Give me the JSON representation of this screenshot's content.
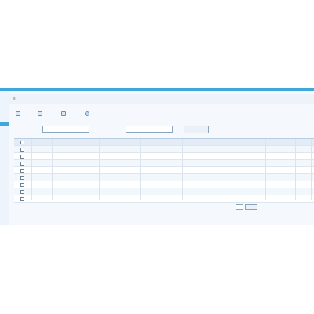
{
  "breadcrumb": {
    "icon": "home-icon",
    "path": ""
  },
  "toolbar": [
    {
      "name": "add-button",
      "icon": "add-icon",
      "label": ""
    },
    {
      "name": "edit-button",
      "icon": "edit-icon",
      "label": ""
    },
    {
      "name": "delete-button",
      "icon": "delete-icon",
      "label": ""
    },
    {
      "name": "refresh-button",
      "icon": "refresh-icon",
      "label": ""
    }
  ],
  "search": {
    "field1_label": "",
    "field1_value": "",
    "field2_label": "",
    "field2_value": "",
    "button_label": ""
  },
  "table": {
    "columns": [
      "",
      "",
      "",
      "",
      "",
      "",
      "",
      "",
      "",
      ""
    ],
    "rows": [
      [
        "",
        "",
        "",
        "",
        "",
        "",
        "",
        "",
        "",
        ""
      ],
      [
        "",
        "",
        "",
        "",
        "",
        "",
        "",
        "",
        "",
        ""
      ],
      [
        "",
        "",
        "",
        "",
        "",
        "",
        "",
        "",
        "",
        ""
      ],
      [
        "",
        "",
        "",
        "",
        "",
        "",
        "",
        "",
        "",
        ""
      ],
      [
        "",
        "",
        "",
        "",
        "",
        "",
        "",
        "",
        "",
        ""
      ],
      [
        "",
        "",
        "",
        "",
        "",
        "",
        "",
        "",
        "",
        ""
      ],
      [
        "",
        "",
        "",
        "",
        "",
        "",
        "",
        "",
        "",
        ""
      ],
      [
        "",
        "",
        "",
        "",
        "",
        "",
        "",
        "",
        "",
        ""
      ]
    ]
  },
  "pager": {
    "text": "",
    "page_value": "",
    "go_label": ""
  },
  "colors": {
    "accent": "#3ea7dc",
    "header_bg": "#e3ecf6",
    "alt_row": "#f2f7fc"
  }
}
